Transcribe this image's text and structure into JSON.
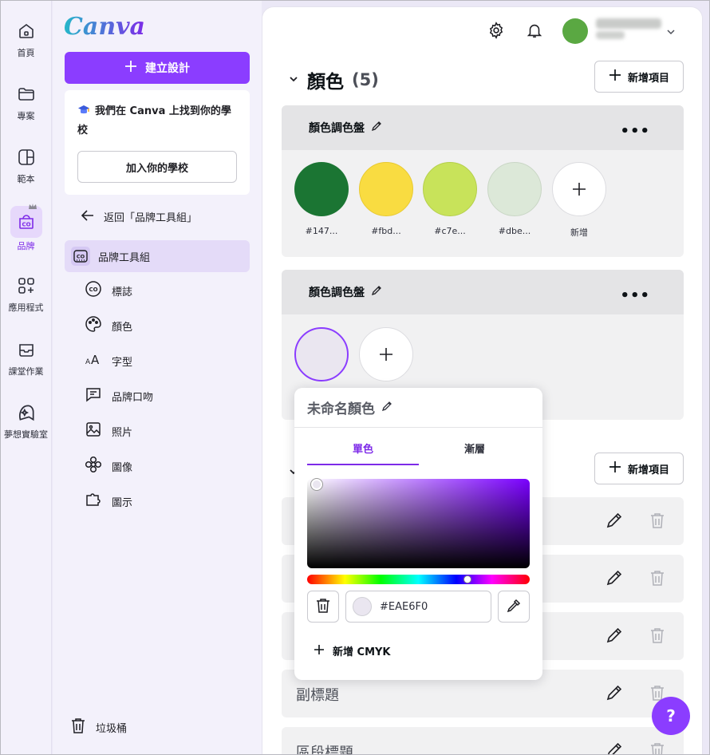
{
  "rail": {
    "items": [
      {
        "label": "首頁",
        "icon": "home-icon"
      },
      {
        "label": "專案",
        "icon": "folder-icon"
      },
      {
        "label": "範本",
        "icon": "template-icon"
      },
      {
        "label": "品牌",
        "icon": "brand-icon",
        "active": true
      },
      {
        "label": "應用程式",
        "icon": "apps-icon"
      },
      {
        "label": "課堂作業",
        "icon": "inbox-icon"
      },
      {
        "label": "夢想實驗室",
        "icon": "dream-lab-icon"
      }
    ]
  },
  "panel": {
    "logo": "Canva",
    "create_label": "建立設計",
    "school_text": "我們在 Canva 上找到你的學校",
    "school_button": "加入你的學校",
    "back_label": "返回「品牌工具組」",
    "kit_label": "品牌工具組",
    "sub_items": [
      "標誌",
      "顏色",
      "字型",
      "品牌口吻",
      "照片",
      "圖像",
      "圖示"
    ],
    "trash_label": "垃圾桶"
  },
  "main": {
    "section_title": "顏色",
    "section_count": "(5)",
    "add_item_label": "新增項目",
    "palette1": {
      "title": "顏色調色盤",
      "swatches": [
        {
          "label": "#147...",
          "color": "#1b7533"
        },
        {
          "label": "#fbd...",
          "color": "#f9dc41"
        },
        {
          "label": "#c7e...",
          "color": "#c8e35a"
        },
        {
          "label": "#dbe...",
          "color": "#dce8d8"
        }
      ],
      "add_label": "新增"
    },
    "palette2": {
      "title": "顏色調色盤",
      "swatch_color": "#eae6f0"
    },
    "add_item_label_2": "新增項目",
    "rows": [
      "副標題",
      "區段標題"
    ]
  },
  "popover": {
    "title": "未命名顏色",
    "tabs": [
      "單色",
      "漸層"
    ],
    "hex_value": "#EAE6F0",
    "hex_color": "#eae6f0",
    "cmyk_label": "新增 CMYK"
  },
  "help_label": "?",
  "colors": {
    "accent": "#8b3dff",
    "active_tab": "#7d2ae8"
  }
}
